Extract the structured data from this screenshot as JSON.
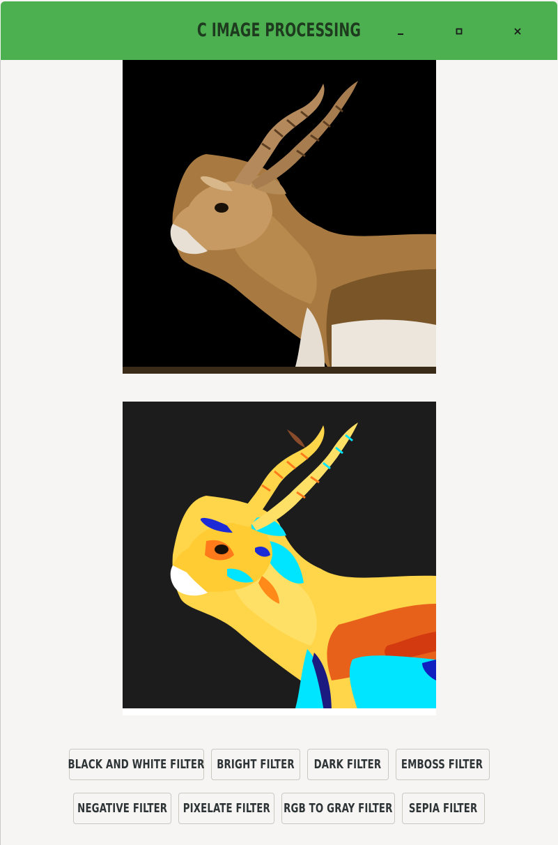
{
  "window": {
    "title": "C Image Processing",
    "accent_color": "#4caf50",
    "controls": [
      "minimize-icon",
      "maximize-icon",
      "close-icon"
    ]
  },
  "images": {
    "original": {
      "subject": "antelope",
      "style": "original photo"
    },
    "filtered": {
      "subject": "antelope",
      "style": "false-color filtered"
    }
  },
  "filters": {
    "row1": [
      {
        "label": "Black and White Filter"
      },
      {
        "label": "Bright Filter"
      },
      {
        "label": "Dark Filter"
      },
      {
        "label": "Emboss Filter"
      }
    ],
    "row2": [
      {
        "label": "Negative Filter"
      },
      {
        "label": "Pixelate Filter"
      },
      {
        "label": "RGB to Gray Filter"
      },
      {
        "label": "Sepia Filter"
      }
    ]
  }
}
